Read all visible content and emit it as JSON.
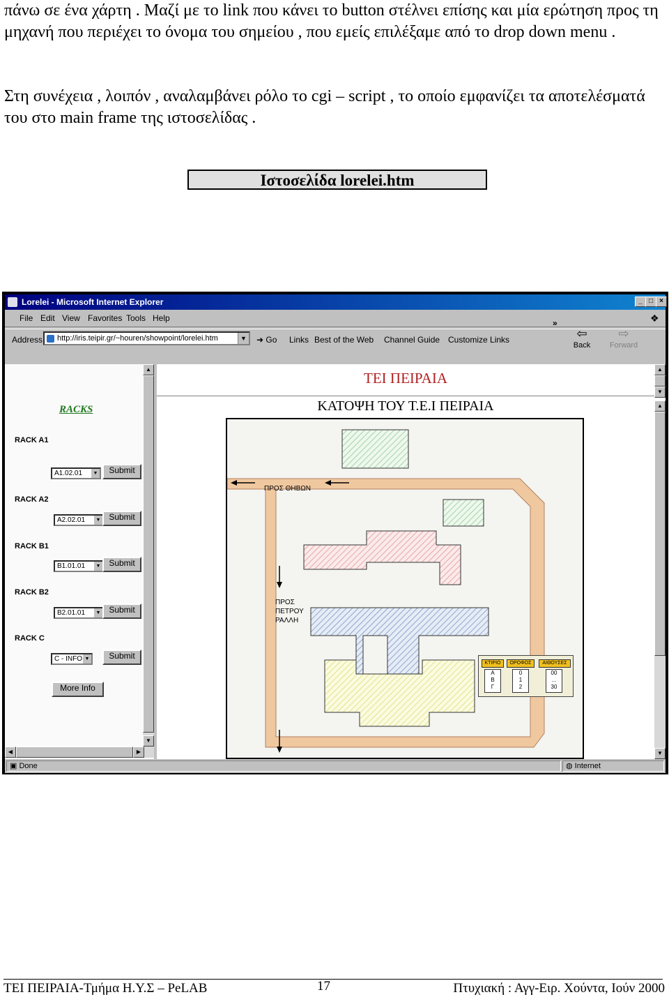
{
  "body": {
    "paragraph1": "πάνω σε ένα χάρτη . Μαζί με το link που κάνει το button στέλνει επίσης και μία ερώτηση προς τη μηχανή που περιέχει το όνομα του σημείου , που εμείς επιλέξαμε από το drop down menu .",
    "paragraph2": "Στη συνέχεια , λοιπόν , αναλαμβάνει ρόλο το cgi – script , το οποίο εμφανίζει τα αποτελέσματά του στο main frame της ιστοσελίδας .",
    "figure_caption": "Ιστοσελίδα lorelei.htm"
  },
  "browser": {
    "title": "Lorelei - Microsoft Internet Explorer",
    "window_buttons": [
      "_",
      "□",
      "×"
    ],
    "menu": [
      "File",
      "Edit",
      "View",
      "Favorites",
      "Tools",
      "Help"
    ],
    "address_label": "Address",
    "address_value": "http://iris.teipir.gr/~houren/showpoint/lorelei.htm",
    "go_label": "Go",
    "links_label": "Links",
    "link_items": [
      "Best of the Web",
      "Channel Guide",
      "Customize Links"
    ],
    "chevron": "»",
    "back_label": "Back",
    "forward_label": "Forward",
    "status_left": "Done",
    "status_zone": "Internet"
  },
  "left_frame": {
    "heading": "RACKS",
    "racks": [
      {
        "label": "RACK A1",
        "selected": "A1.02.01",
        "submit": "Submit"
      },
      {
        "label": "RACK A2",
        "selected": "A2.02.01",
        "submit": "Submit"
      },
      {
        "label": "RACK B1",
        "selected": "B1.01.01",
        "submit": "Submit"
      },
      {
        "label": "RACK B2",
        "selected": "B2.01.01",
        "submit": "Submit"
      },
      {
        "label": "RACK C",
        "selected": "C - INFO",
        "submit": "Submit"
      }
    ],
    "more_info": "More Info"
  },
  "main_frame": {
    "title": "ΤΕΙ ΠΕΙΡΑΙΑ",
    "subtitle": "ΚΑΤΟΨΗ ΤΟΥ Τ.Ε.Ι ΠΕΙΡΑΙΑ",
    "road_top": "ΠΡΟΣ ΘΗΒΩΝ",
    "road_side": "ΠΡΟΣ ΠΕΤΡΟΥ ΡΑΛΛΗ",
    "legend": {
      "headers": [
        "ΚΤΙΡΙΟ",
        "ΟΡΟΦΟΣ",
        "ΑΙΘΟΥΣΕΣ"
      ],
      "col1": [
        "Α",
        "Β",
        "Γ"
      ],
      "col2": [
        "0",
        "1",
        "2"
      ],
      "col3": [
        "00",
        "...",
        "30"
      ]
    }
  },
  "footer": {
    "left": "ΤΕΙ ΠΕΙΡΑΙΑ-Τμήμα Η.Υ.Σ – PeLAB",
    "page": "17",
    "right": "Πτυχιακή : Αγγ-Ειρ. Χούντα, Ιούν 2000"
  },
  "colors": {
    "road": "#f0c8a0",
    "building_red": "#e09090",
    "building_blue": "#7090c0",
    "building_yellow": "#e8ec80",
    "building_green": "#90c890",
    "title_red": "#b02020",
    "racks_green": "#1f7a1f"
  }
}
